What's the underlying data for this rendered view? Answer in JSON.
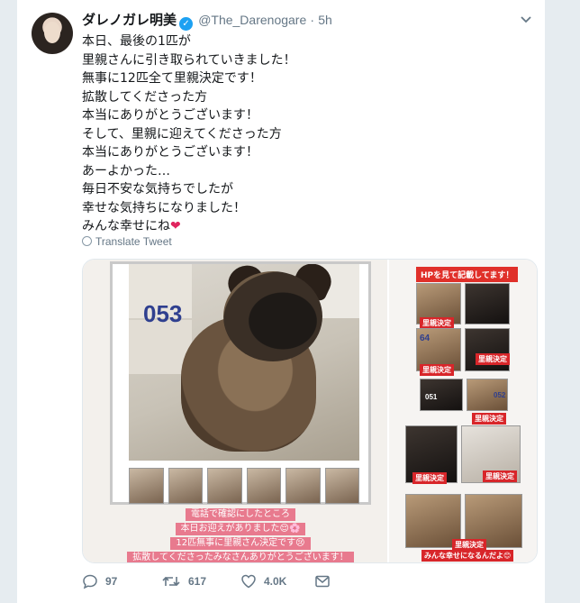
{
  "tweet": {
    "author_name": "ダレノガレ明美",
    "handle": "@The_Darenogare",
    "separator": "·",
    "time": "5h",
    "lines": [
      "本日、最後の1匹が",
      "里親さんに引き取られていきました！",
      "無事に12匹全て里親決定です！",
      "拡散してくださった方",
      "本当にありがとうございます！",
      "そして、里親に迎えてくださった方",
      "本当にありがとうございます！",
      "あーよかった…",
      "毎日不安な気持ちでしたが",
      "幸せな気持ちになりました！",
      "みんな幸せにね"
    ],
    "heart_emoji": "❤",
    "translate_label": "Translate Tweet"
  },
  "media": {
    "left": {
      "number_label": "053",
      "caption_lines": [
        "電話で確認にしたところ",
        "本日お迎えがありました😌🌸",
        "12匹無事に里親さん決定です😢",
        "拡散してくださったみなさんありがとうございます！"
      ]
    },
    "right": {
      "hp_label": "HPを見て記載してます！",
      "number_64": "64",
      "number_051": "051",
      "number_052": "052",
      "tag_small": "里親決定",
      "tag": "里親決定",
      "last_tag": "みんな幸せになるんだよ😊"
    }
  },
  "actions": {
    "reply_count": "97",
    "retweet_count": "617",
    "like_count": "4.0K"
  },
  "colors": {
    "link_blue": "#1da1f2",
    "muted": "#657786",
    "heart": "#e0245e",
    "tag_red": "#d8262a",
    "caption_pink": "#e87a8e"
  },
  "icons": [
    "chevron-down-icon",
    "verified-badge-icon",
    "globe-icon",
    "reply-icon",
    "retweet-icon",
    "like-icon",
    "message-icon"
  ]
}
